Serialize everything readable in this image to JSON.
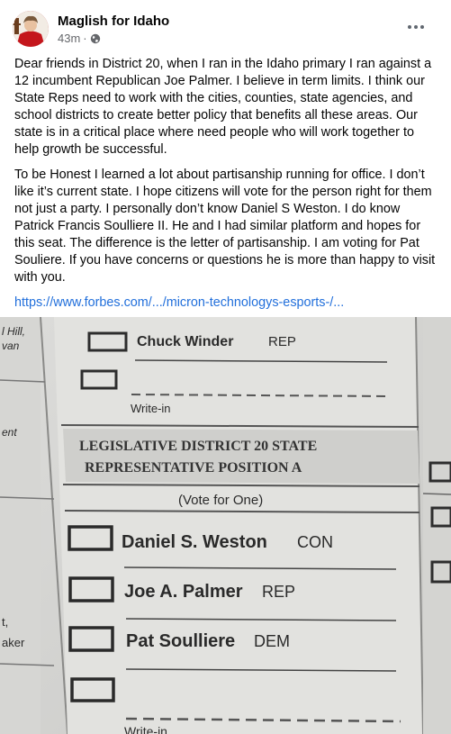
{
  "post": {
    "author": "Maglish for Idaho",
    "time": "43m",
    "separator": "·",
    "privacy_icon": "globe-icon",
    "more_icon": "more-dots-icon",
    "paragraph1": "Dear friends in District 20, when I ran in the Idaho primary I ran against a 12 incumbent Republican Joe Palmer.  I believe in term limits.  I think our State Reps need to work with the cities, counties, state agencies, and school districts to create better policy that benefits all these areas. Our state is in a critical place where need people who will work together to help growth be successful.",
    "paragraph2": "To be Honest I learned a lot about partisanship running for office.  I don’t like it’s current state. I hope citizens will vote for the person right for them not just a party. I personally don’t know Daniel S Weston.  I do know Patrick Francis Soulliere II.  He and I had similar platform and hopes for this seat. The difference is the letter of partisanship.  I am voting for Pat Souliere.  If you have concerns or questions he is more than happy to visit with you.",
    "link": "https://www.forbes.com/.../micron-technologys-esports-/..."
  },
  "ballot": {
    "left_fragments": [
      "l Hill,",
      "van",
      "ent",
      "t,",
      "aker"
    ],
    "top_candidate": {
      "name": "Chuck Winder",
      "party": "REP"
    },
    "write_in_label": "Write-in",
    "write_in_label_bottom": "Write-in",
    "heading_line1": "LEGISLATIVE DISTRICT 20 STATE",
    "heading_line2": "REPRESENTATIVE POSITION A",
    "instruction": "(Vote for One)",
    "candidates": [
      {
        "name": "Daniel S. Weston",
        "party": "CON"
      },
      {
        "name": "Joe A. Palmer",
        "party": "REP"
      },
      {
        "name": "Pat Soulliere",
        "party": "DEM"
      }
    ]
  }
}
